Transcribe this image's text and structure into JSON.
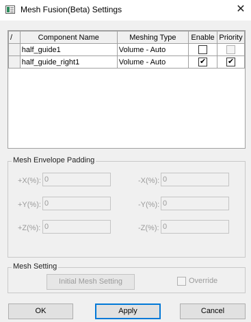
{
  "window": {
    "title": "Mesh Fusion(Beta) Settings",
    "close_glyph": "✕"
  },
  "table": {
    "sort_glyph": "/",
    "headers": [
      "Component Name",
      "Meshing Type",
      "Enable",
      "Priority"
    ],
    "rows": [
      {
        "name": "half_guide1",
        "meshing_type": "Volume - Auto",
        "enable": false,
        "priority": false,
        "priority_disabled": true
      },
      {
        "name": "half_guide_right1",
        "meshing_type": "Volume - Auto",
        "enable": true,
        "priority": true,
        "priority_disabled": false
      }
    ]
  },
  "padding": {
    "label": "Mesh Envelope Padding",
    "fields": {
      "px": {
        "label": "+X(%):",
        "value": "0"
      },
      "nx": {
        "label": "-X(%):",
        "value": "0"
      },
      "py": {
        "label": "+Y(%):",
        "value": "0"
      },
      "ny": {
        "label": "-Y(%):",
        "value": "0"
      },
      "pz": {
        "label": "+Z(%):",
        "value": "0"
      },
      "nz": {
        "label": "-Z(%):",
        "value": "0"
      }
    }
  },
  "mesh_setting": {
    "label": "Mesh Setting",
    "initial_button": "Initial Mesh Setting",
    "override_label": "Override",
    "override_checked": false
  },
  "buttons": {
    "ok": "OK",
    "apply": "Apply",
    "cancel": "Cancel"
  }
}
